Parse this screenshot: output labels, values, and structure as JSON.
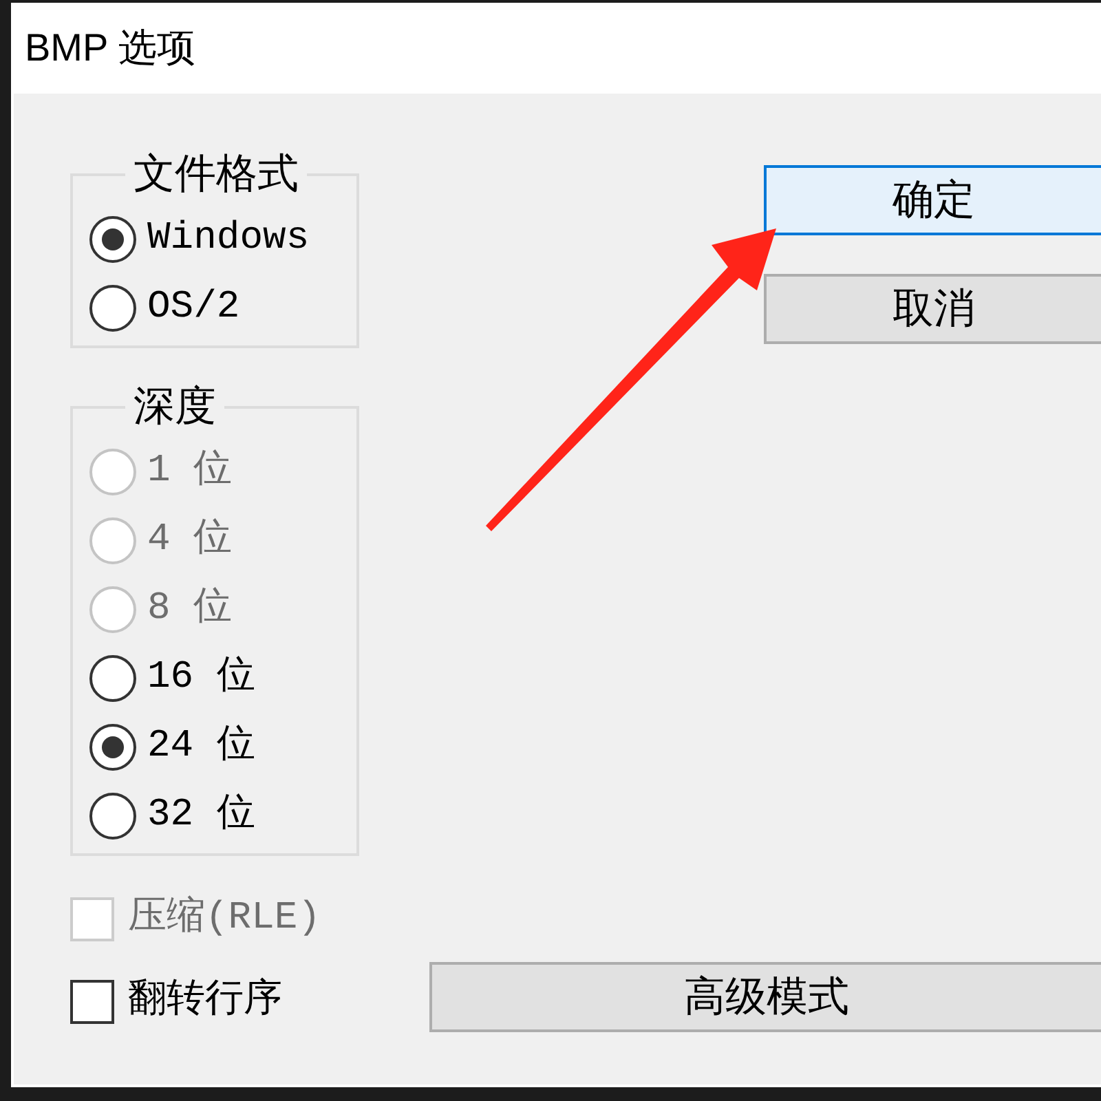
{
  "window": {
    "title": "BMP 选项"
  },
  "file_format": {
    "label": "文件格式",
    "options": [
      {
        "label": "Windows",
        "selected": true,
        "disabled": false
      },
      {
        "label": "OS/2",
        "selected": false,
        "disabled": false
      }
    ]
  },
  "depth": {
    "label": "深度",
    "options": [
      {
        "label": "1 位",
        "selected": false,
        "disabled": true
      },
      {
        "label": "4 位",
        "selected": false,
        "disabled": true
      },
      {
        "label": "8 位",
        "selected": false,
        "disabled": true
      },
      {
        "label": "16 位",
        "selected": false,
        "disabled": false
      },
      {
        "label": "24 位",
        "selected": true,
        "disabled": false
      },
      {
        "label": "32 位",
        "selected": false,
        "disabled": false
      }
    ]
  },
  "checkboxes": [
    {
      "label": "压缩(RLE)",
      "checked": false,
      "disabled": true
    },
    {
      "label": "翻转行序",
      "checked": false,
      "disabled": false
    }
  ],
  "buttons": [
    {
      "label": "确定",
      "focused": true
    },
    {
      "label": "取消",
      "focused": false
    }
  ],
  "advanced_button": {
    "label": "高级模式"
  }
}
